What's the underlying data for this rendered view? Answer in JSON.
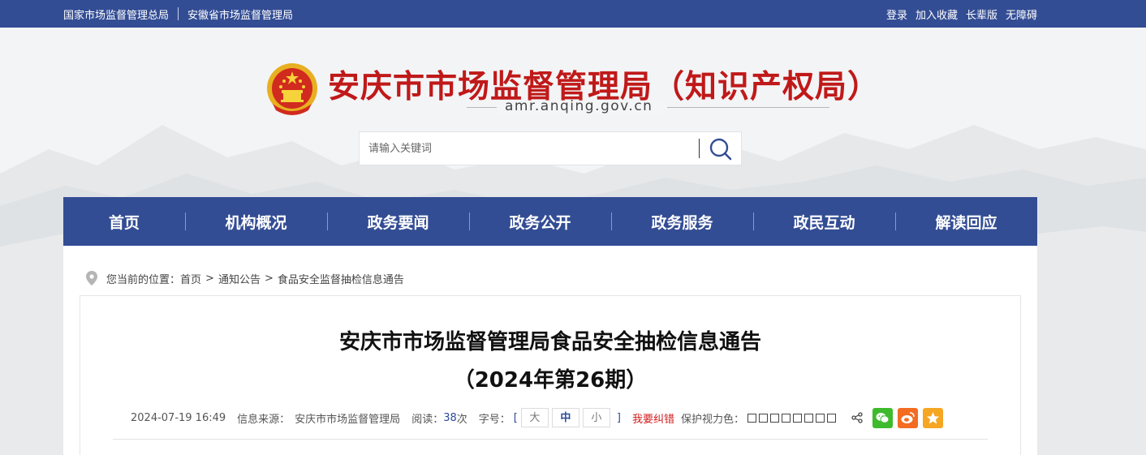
{
  "topbar": {
    "links_left": [
      "国家市场监督管理总局",
      "安徽省市场监督管理局"
    ],
    "links_right": [
      "登录",
      "加入收藏",
      "长辈版",
      "无障碍"
    ]
  },
  "header": {
    "site_title": "安庆市市场监督管理局（知识产权局）",
    "domain": "amr.anqing.gov.cn"
  },
  "search": {
    "placeholder": "请输入关键词"
  },
  "nav": {
    "items": [
      "首页",
      "机构概况",
      "政务要闻",
      "政务公开",
      "政务服务",
      "政民互动",
      "解读回应"
    ]
  },
  "breadcrumb": {
    "prefix": "您当前的位置：",
    "items": [
      "首页",
      "通知公告",
      "食品安全监督抽检信息通告"
    ],
    "separator": ">"
  },
  "article": {
    "title": "安庆市市场监督管理局食品安全抽检信息通告",
    "subtitle": "（2024年第26期）",
    "date": "2024-07-19 16:49",
    "source_label": "信息来源：",
    "source": "安庆市市场监督管理局",
    "reads_label": "阅读：",
    "reads": "38",
    "reads_unit": "次",
    "fontsize_label": "字号：",
    "fontsize_options": [
      "大",
      "中",
      "小"
    ],
    "fontsize_selected": "中",
    "correction": "我要纠错",
    "color_label": "保护视力色："
  },
  "colors": {
    "brand_blue": "#334d94",
    "title_red": "#c01919",
    "correction_red": "#d21c1c",
    "wechat": "#3dbb2c",
    "weibo": "#f36c21",
    "favorite": "#f5a623"
  }
}
